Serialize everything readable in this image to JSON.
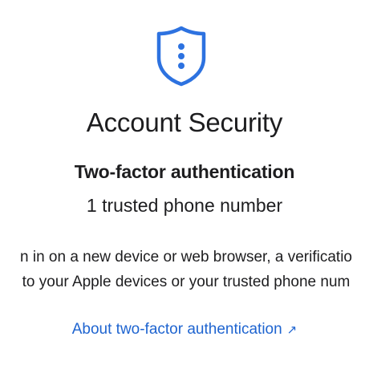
{
  "header": {
    "icon": "shield-with-ellipsis-icon",
    "title": "Account Security"
  },
  "two_factor": {
    "heading": "Two-factor authentication",
    "status": "1 trusted phone number",
    "description_line1": "n in on a new device or web browser, a verificatio",
    "description_line2": "to your Apple devices or your trusted phone num"
  },
  "link": {
    "label": "About two-factor authentication",
    "arrow": "↗"
  },
  "colors": {
    "accent": "#1e64d0",
    "text": "#1d1d1f",
    "icon_stroke": "#2d72e0"
  }
}
